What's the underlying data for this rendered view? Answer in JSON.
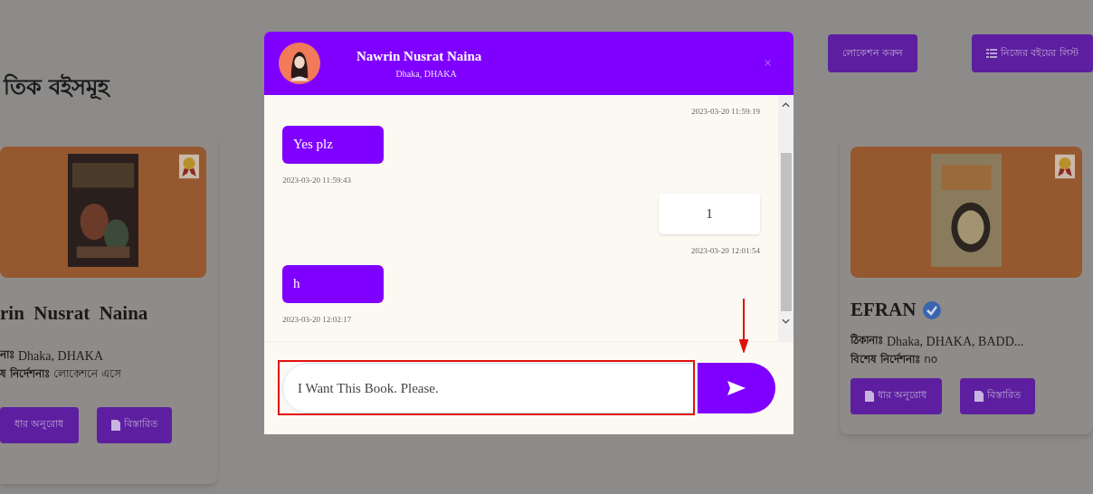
{
  "page": {
    "heading": "তিক বইসমূহ",
    "top_buttons": [
      {
        "kind": "plain",
        "label": "লোকেশন করুন"
      },
      {
        "kind": "list",
        "label": "নিজের বইয়ের লিস্ট"
      }
    ],
    "cards": [
      {
        "name": "rin  Nusrat  Naina",
        "verified": false,
        "address_label": "নাঃ",
        "address": "Dhaka, DHAKA",
        "note_label": "ষ নির্দেশনাঃ",
        "note": "লোকেশনে এসে",
        "buttons": [
          {
            "kind": "plain",
            "label": "ধার অনুরোধ"
          },
          {
            "kind": "doc",
            "label": "বিস্তারিত"
          }
        ]
      },
      {
        "name": "EFRAN",
        "verified": true,
        "address_label": "ঠিকানাঃ",
        "address": "Dhaka, DHAKA, BADD...",
        "note_label": "বিশেষ নির্দেশনাঃ",
        "note": "no",
        "buttons": [
          {
            "kind": "doc",
            "label": "ধার অনুরোধ"
          },
          {
            "kind": "doc",
            "label": "বিস্তারিত"
          }
        ]
      }
    ]
  },
  "chat": {
    "contact": {
      "name": "Nawrin Nusrat Naina",
      "location": "Dhaka, DHAKA"
    },
    "close": "×",
    "messages": [
      {
        "kind": "outgoing",
        "time": "2023-03-20 11:59:19"
      },
      {
        "kind": "incoming",
        "text": "Yes plz",
        "time": "2023-03-20 11:59:43"
      },
      {
        "kind": "outgoing",
        "text": "1",
        "time": "2023-03-20 12:01:54"
      },
      {
        "kind": "incoming",
        "text": "h",
        "time": "2023-03-20 12:02:17"
      }
    ],
    "input": {
      "value": "I Want This Book. Please."
    }
  }
}
